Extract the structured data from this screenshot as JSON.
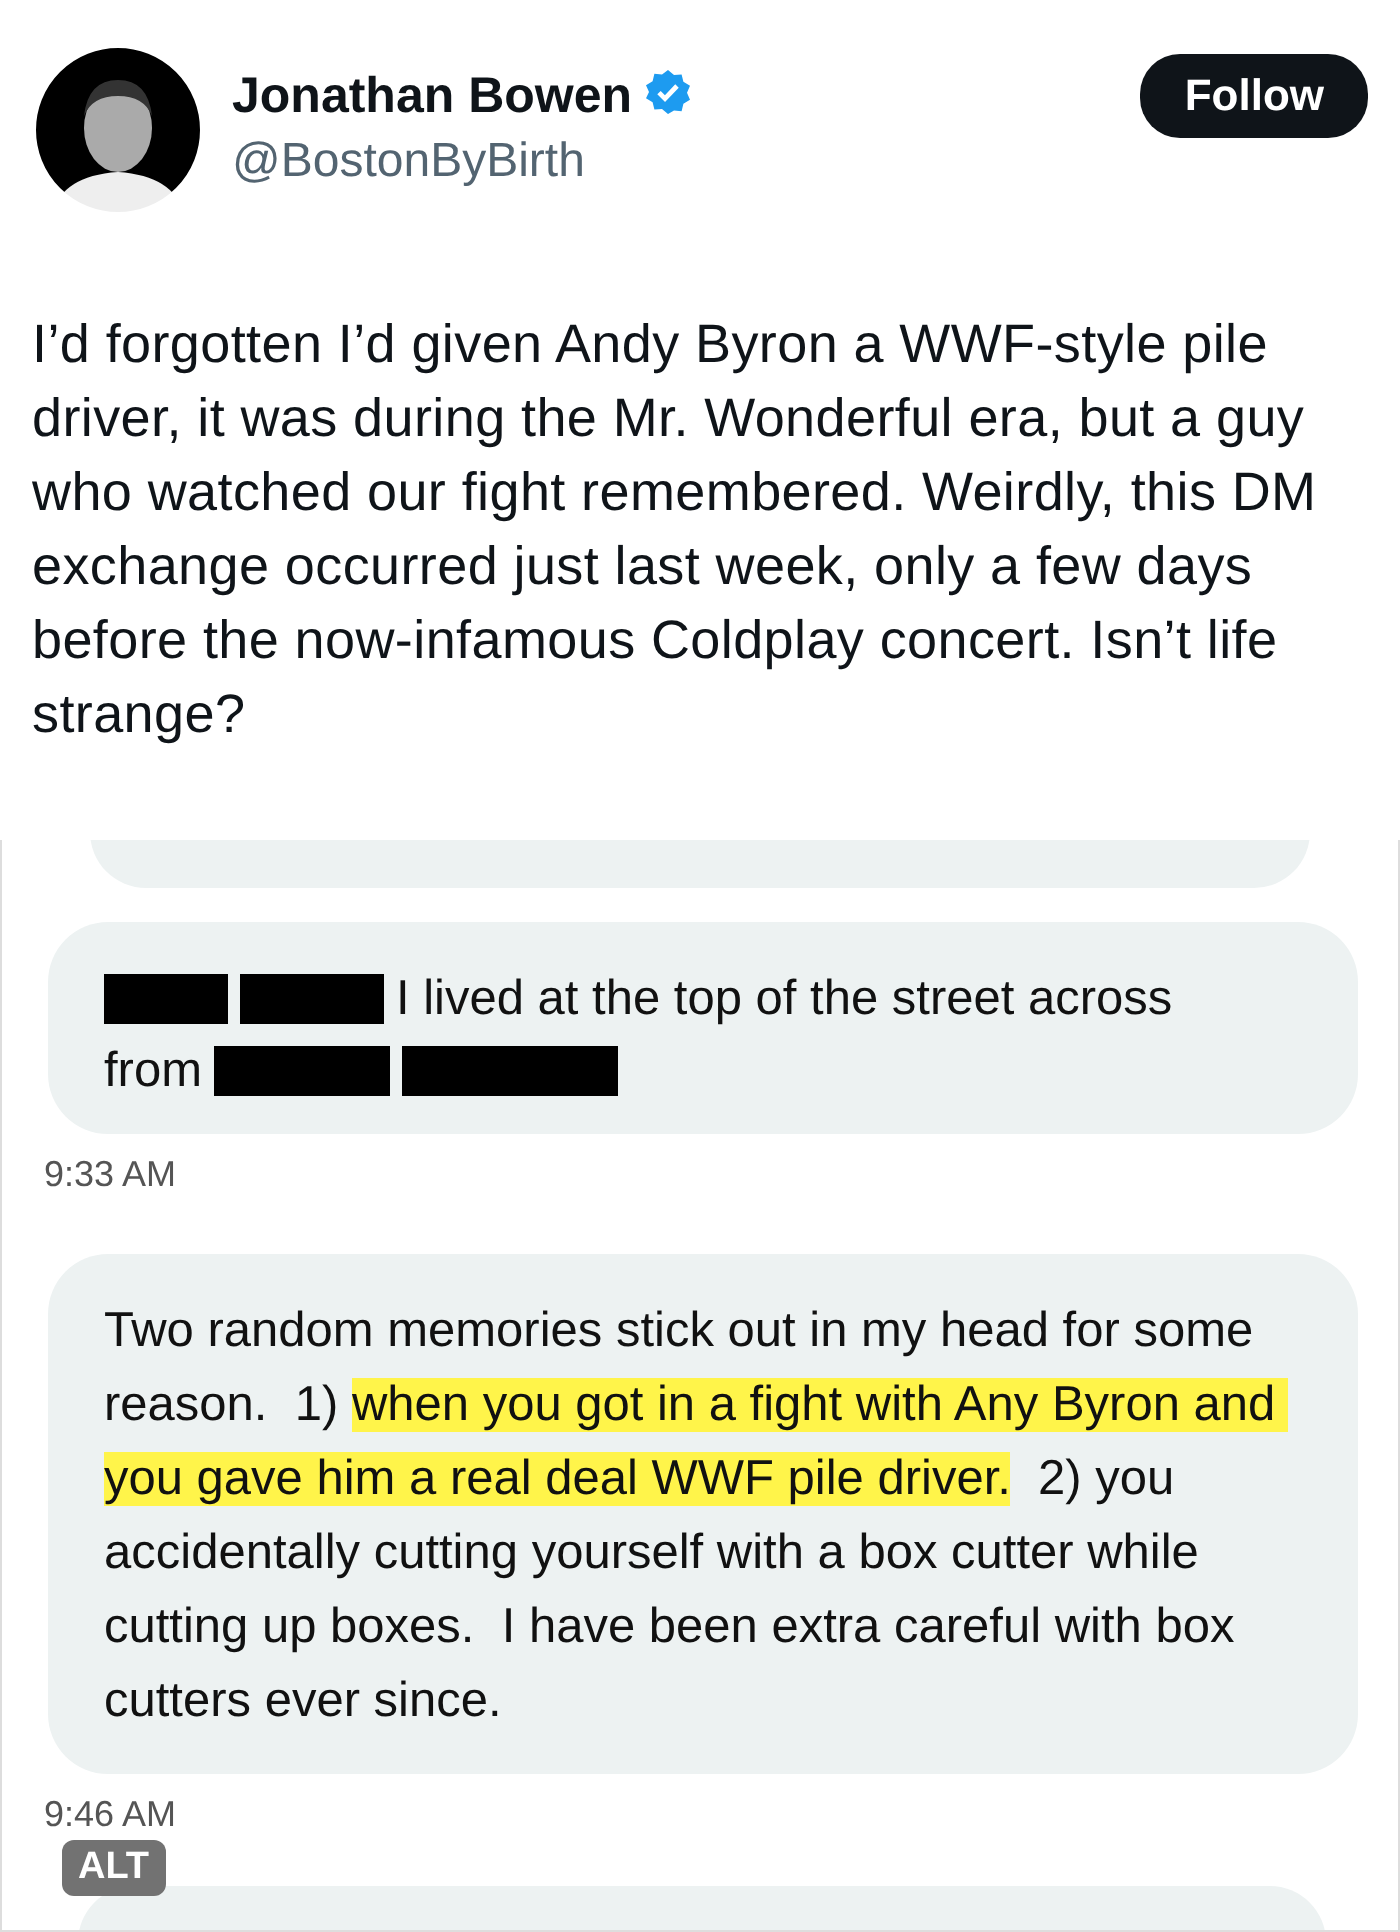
{
  "author": {
    "name": "Jonathan Bowen",
    "verified": true,
    "handle": "@BostonByBirth"
  },
  "follow_button": {
    "label": "Follow"
  },
  "tweet_text": "I’d forgotten I’d given Andy Byron a WWF-style pile driver, it was during the Mr. Wonderful era, but a guy who watched our fight remembered. Weirdly, this DM exchange occurred just last week, only a few days before the now-infamous Coldplay concert. Isn’t life strange?",
  "attached_image": {
    "alt_badge": "ALT",
    "messages": [
      {
        "lines": [
          [
            {
              "kind": "redaction"
            },
            {
              "kind": "redaction"
            },
            {
              "kind": "text",
              "text": "I lived at the top of the street across"
            }
          ],
          [
            {
              "kind": "text",
              "text": "from"
            },
            {
              "kind": "redaction"
            },
            {
              "kind": "redaction"
            }
          ]
        ],
        "time": "9:33 AM"
      },
      {
        "segments": [
          {
            "text": "Two random memories stick out in my head for some reason.  1) ",
            "highlighted": false
          },
          {
            "text": "when you got in a fight with Any Byron and you gave him a real deal WWF pile driver.",
            "highlighted": true
          },
          {
            "text": "  2) you accidentally cutting yourself with a box cutter while cutting up boxes.  I have been extra careful with box cutters ever since.",
            "highlighted": false
          }
        ],
        "time": "9:46 AM"
      }
    ]
  }
}
